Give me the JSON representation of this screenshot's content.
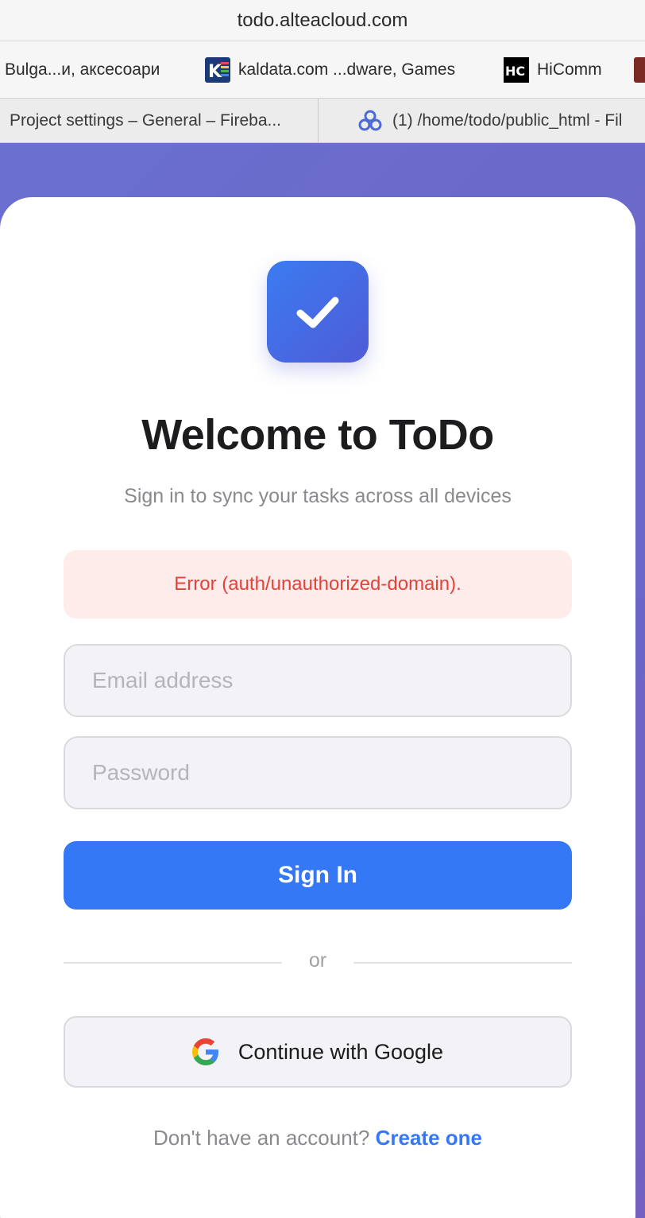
{
  "browser": {
    "url": "todo.alteacloud.com",
    "bookmarks": [
      {
        "label": "Bulga...и, аксесоари",
        "icon": "none"
      },
      {
        "label": "kaldata.com ...dware, Games",
        "icon": "kaldata-icon"
      },
      {
        "label": "HiComm",
        "icon": "hicomm-icon"
      }
    ],
    "tabs": [
      {
        "label": "Project settings – General – Fireba..."
      },
      {
        "label": "(1) /home/todo/public_html - Fil",
        "icon": "cpanel-icon"
      }
    ]
  },
  "login": {
    "title": "Welcome to ToDo",
    "subtitle": "Sign in to sync your tasks across all devices",
    "error": "Error (auth/unauthorized-domain).",
    "email_placeholder": "Email address",
    "password_placeholder": "Password",
    "signin_label": "Sign In",
    "divider_text": "or",
    "google_label": "Continue with Google",
    "footer_text": "Don't have an account?",
    "footer_link": "Create one"
  },
  "colors": {
    "accent": "#3478f6",
    "gradient_start": "#3b7bf0",
    "gradient_end": "#4f5bd8",
    "background": "#6a6fcf",
    "error_text": "#e0433a",
    "error_bg": "#fdecea"
  }
}
